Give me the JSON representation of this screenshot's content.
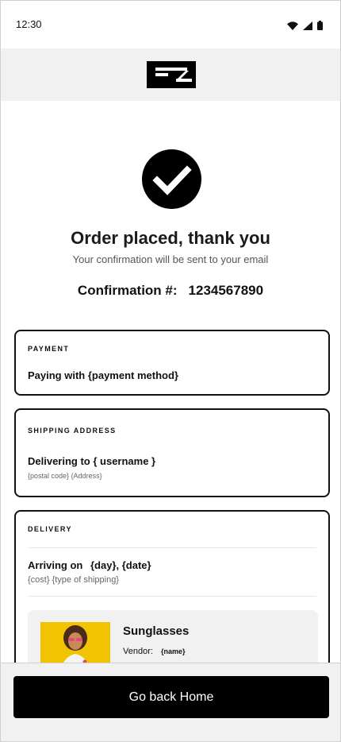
{
  "status_bar": {
    "time": "12:30"
  },
  "header": {
    "logo_text": "EZ"
  },
  "confirmation": {
    "icon": "checkmark-icon",
    "title": "Order placed, thank you",
    "subtitle": "Your confirmation will be sent to your email",
    "label": "Confirmation #:",
    "number": "1234567890"
  },
  "payment": {
    "heading": "PAYMENT",
    "text": "Paying with {payment method}"
  },
  "shipping": {
    "heading": "SHIPPING ADDRESS",
    "text": "Delivering to { username }",
    "subtext": "{postal code} {Address}"
  },
  "delivery": {
    "heading": "DELIVERY",
    "arriving_label": "Arriving on",
    "arriving_value": "{day}, {date}",
    "subtext": "{cost} {type of shipping}",
    "product": {
      "name": "Sunglasses",
      "vendor_label": "Vendor:",
      "vendor_value": "{name}"
    }
  },
  "footer": {
    "button_label": "Go back Home"
  },
  "colors": {
    "primary": "#000000",
    "header_bg": "#f1f1f1",
    "product_image_bg": "#f2c300"
  }
}
